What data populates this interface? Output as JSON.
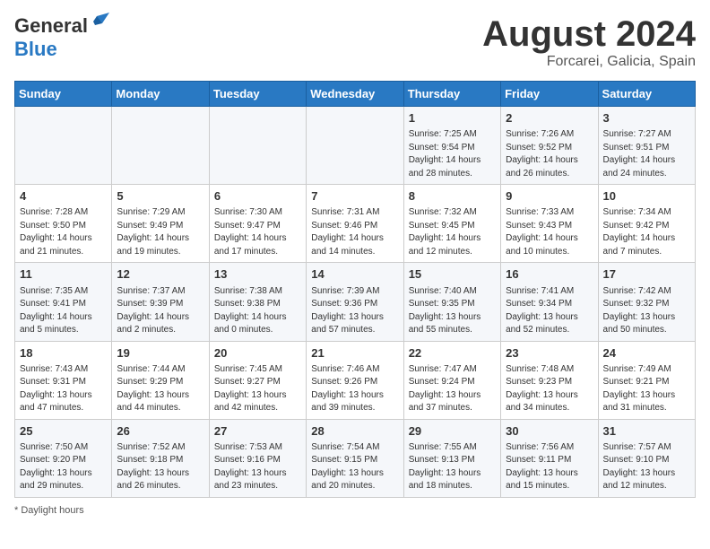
{
  "header": {
    "logo_general": "General",
    "logo_blue": "Blue",
    "month_title": "August 2024",
    "location": "Forcarei, Galicia, Spain"
  },
  "weekdays": [
    "Sunday",
    "Monday",
    "Tuesday",
    "Wednesday",
    "Thursday",
    "Friday",
    "Saturday"
  ],
  "weeks": [
    [
      {
        "day": "",
        "info": ""
      },
      {
        "day": "",
        "info": ""
      },
      {
        "day": "",
        "info": ""
      },
      {
        "day": "",
        "info": ""
      },
      {
        "day": "1",
        "info": "Sunrise: 7:25 AM\nSunset: 9:54 PM\nDaylight: 14 hours and 28 minutes."
      },
      {
        "day": "2",
        "info": "Sunrise: 7:26 AM\nSunset: 9:52 PM\nDaylight: 14 hours and 26 minutes."
      },
      {
        "day": "3",
        "info": "Sunrise: 7:27 AM\nSunset: 9:51 PM\nDaylight: 14 hours and 24 minutes."
      }
    ],
    [
      {
        "day": "4",
        "info": "Sunrise: 7:28 AM\nSunset: 9:50 PM\nDaylight: 14 hours and 21 minutes."
      },
      {
        "day": "5",
        "info": "Sunrise: 7:29 AM\nSunset: 9:49 PM\nDaylight: 14 hours and 19 minutes."
      },
      {
        "day": "6",
        "info": "Sunrise: 7:30 AM\nSunset: 9:47 PM\nDaylight: 14 hours and 17 minutes."
      },
      {
        "day": "7",
        "info": "Sunrise: 7:31 AM\nSunset: 9:46 PM\nDaylight: 14 hours and 14 minutes."
      },
      {
        "day": "8",
        "info": "Sunrise: 7:32 AM\nSunset: 9:45 PM\nDaylight: 14 hours and 12 minutes."
      },
      {
        "day": "9",
        "info": "Sunrise: 7:33 AM\nSunset: 9:43 PM\nDaylight: 14 hours and 10 minutes."
      },
      {
        "day": "10",
        "info": "Sunrise: 7:34 AM\nSunset: 9:42 PM\nDaylight: 14 hours and 7 minutes."
      }
    ],
    [
      {
        "day": "11",
        "info": "Sunrise: 7:35 AM\nSunset: 9:41 PM\nDaylight: 14 hours and 5 minutes."
      },
      {
        "day": "12",
        "info": "Sunrise: 7:37 AM\nSunset: 9:39 PM\nDaylight: 14 hours and 2 minutes."
      },
      {
        "day": "13",
        "info": "Sunrise: 7:38 AM\nSunset: 9:38 PM\nDaylight: 14 hours and 0 minutes."
      },
      {
        "day": "14",
        "info": "Sunrise: 7:39 AM\nSunset: 9:36 PM\nDaylight: 13 hours and 57 minutes."
      },
      {
        "day": "15",
        "info": "Sunrise: 7:40 AM\nSunset: 9:35 PM\nDaylight: 13 hours and 55 minutes."
      },
      {
        "day": "16",
        "info": "Sunrise: 7:41 AM\nSunset: 9:34 PM\nDaylight: 13 hours and 52 minutes."
      },
      {
        "day": "17",
        "info": "Sunrise: 7:42 AM\nSunset: 9:32 PM\nDaylight: 13 hours and 50 minutes."
      }
    ],
    [
      {
        "day": "18",
        "info": "Sunrise: 7:43 AM\nSunset: 9:31 PM\nDaylight: 13 hours and 47 minutes."
      },
      {
        "day": "19",
        "info": "Sunrise: 7:44 AM\nSunset: 9:29 PM\nDaylight: 13 hours and 44 minutes."
      },
      {
        "day": "20",
        "info": "Sunrise: 7:45 AM\nSunset: 9:27 PM\nDaylight: 13 hours and 42 minutes."
      },
      {
        "day": "21",
        "info": "Sunrise: 7:46 AM\nSunset: 9:26 PM\nDaylight: 13 hours and 39 minutes."
      },
      {
        "day": "22",
        "info": "Sunrise: 7:47 AM\nSunset: 9:24 PM\nDaylight: 13 hours and 37 minutes."
      },
      {
        "day": "23",
        "info": "Sunrise: 7:48 AM\nSunset: 9:23 PM\nDaylight: 13 hours and 34 minutes."
      },
      {
        "day": "24",
        "info": "Sunrise: 7:49 AM\nSunset: 9:21 PM\nDaylight: 13 hours and 31 minutes."
      }
    ],
    [
      {
        "day": "25",
        "info": "Sunrise: 7:50 AM\nSunset: 9:20 PM\nDaylight: 13 hours and 29 minutes."
      },
      {
        "day": "26",
        "info": "Sunrise: 7:52 AM\nSunset: 9:18 PM\nDaylight: 13 hours and 26 minutes."
      },
      {
        "day": "27",
        "info": "Sunrise: 7:53 AM\nSunset: 9:16 PM\nDaylight: 13 hours and 23 minutes."
      },
      {
        "day": "28",
        "info": "Sunrise: 7:54 AM\nSunset: 9:15 PM\nDaylight: 13 hours and 20 minutes."
      },
      {
        "day": "29",
        "info": "Sunrise: 7:55 AM\nSunset: 9:13 PM\nDaylight: 13 hours and 18 minutes."
      },
      {
        "day": "30",
        "info": "Sunrise: 7:56 AM\nSunset: 9:11 PM\nDaylight: 13 hours and 15 minutes."
      },
      {
        "day": "31",
        "info": "Sunrise: 7:57 AM\nSunset: 9:10 PM\nDaylight: 13 hours and 12 minutes."
      }
    ]
  ],
  "footer": {
    "note": "Daylight hours"
  }
}
